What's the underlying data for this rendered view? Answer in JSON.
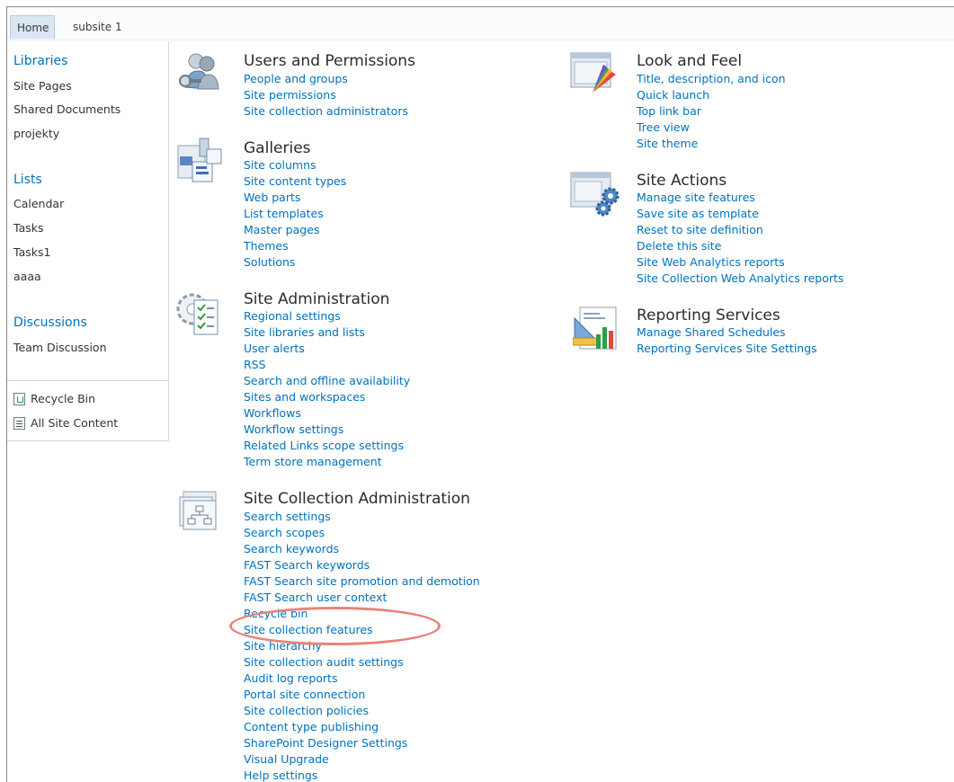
{
  "topbar": {
    "tabs": [
      {
        "label": "Home"
      },
      {
        "label": "subsite 1"
      }
    ]
  },
  "quicklaunch": {
    "libraries": {
      "heading": "Libraries",
      "items": [
        "Site Pages",
        "Shared Documents",
        "projekty"
      ]
    },
    "lists": {
      "heading": "Lists",
      "items": [
        "Calendar",
        "Tasks",
        "Tasks1",
        "aaaa"
      ]
    },
    "discussions": {
      "heading": "Discussions",
      "items": [
        "Team Discussion"
      ]
    },
    "bottom": [
      "Recycle Bin",
      "All Site Content"
    ]
  },
  "groups": {
    "users": {
      "title": "Users and Permissions",
      "icon": "users-permissions-icon",
      "links": [
        "People and groups",
        "Site permissions",
        "Site collection administrators"
      ]
    },
    "galleries": {
      "title": "Galleries",
      "icon": "galleries-icon",
      "links": [
        "Site columns",
        "Site content types",
        "Web parts",
        "List templates",
        "Master pages",
        "Themes",
        "Solutions"
      ]
    },
    "siteadmin": {
      "title": "Site Administration",
      "icon": "site-administration-icon",
      "links": [
        "Regional settings",
        "Site libraries and lists",
        "User alerts",
        "RSS",
        "Search and offline availability",
        "Sites and workspaces",
        "Workflows",
        "Workflow settings",
        "Related Links scope settings",
        "Term store management"
      ]
    },
    "sitecolladmin": {
      "title": "Site Collection Administration",
      "icon": "site-collection-administration-icon",
      "links": [
        "Search settings",
        "Search scopes",
        "Search keywords",
        "FAST Search keywords",
        "FAST Search site promotion and demotion",
        "FAST Search user context",
        "Recycle bin",
        "Site collection features",
        "Site hierarchy",
        "Site collection audit settings",
        "Audit log reports",
        "Portal site connection",
        "Site collection policies",
        "Content type publishing",
        "SharePoint Designer Settings",
        "Visual Upgrade",
        "Help settings"
      ]
    },
    "lookfeel": {
      "title": "Look and Feel",
      "icon": "look-and-feel-icon",
      "links": [
        "Title, description, and icon",
        "Quick launch",
        "Top link bar",
        "Tree view",
        "Site theme"
      ]
    },
    "siteactions": {
      "title": "Site Actions",
      "icon": "site-actions-icon",
      "links": [
        "Manage site features",
        "Save site as template",
        "Reset to site definition",
        "Delete this site",
        "Site Web Analytics reports",
        "Site Collection Web Analytics reports"
      ]
    },
    "reporting": {
      "title": "Reporting Services",
      "icon": "reporting-services-icon",
      "links": [
        "Manage Shared Schedules",
        "Reporting Services Site Settings"
      ]
    }
  },
  "colors": {
    "link": "#0072bc",
    "highlight": "#e8837b"
  }
}
